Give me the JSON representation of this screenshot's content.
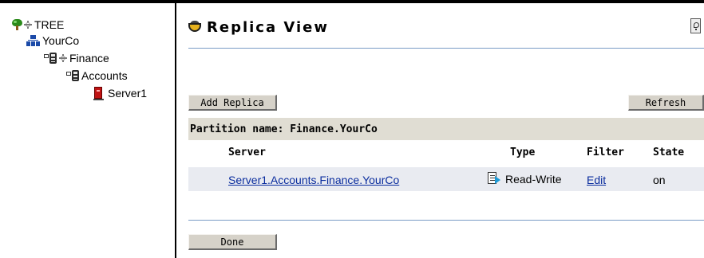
{
  "tree": {
    "nodes": [
      {
        "label": "TREE",
        "icon": "tree-icon"
      },
      {
        "label": "YourCo",
        "icon": "organization-icon"
      },
      {
        "label": "Finance",
        "icon": "partition-icon"
      },
      {
        "label": "Accounts",
        "icon": "partition-icon"
      },
      {
        "label": "Server1",
        "icon": "server-icon"
      }
    ]
  },
  "header": {
    "title": "Replica View",
    "icon": "replica-view-icon",
    "help_icon": "help-icon"
  },
  "toolbar": {
    "add_replica_label": "Add Replica",
    "refresh_label": "Refresh"
  },
  "partition": {
    "label": "Partition name: Finance.YourCo"
  },
  "table": {
    "columns": [
      "Server",
      "Type",
      "Filter",
      "State"
    ],
    "rows": [
      {
        "server": "Server1.Accounts.Finance.YourCo",
        "type": "Read-Write",
        "filter": "Edit",
        "state": "on"
      }
    ]
  },
  "footer": {
    "done_label": "Done"
  },
  "colors": {
    "link": "#0a2d9e",
    "button_face": "#d6d2c9",
    "partition_bar": "#e0ddd3",
    "row_background": "#e9ebf1",
    "rule": "#7a9cc6"
  }
}
